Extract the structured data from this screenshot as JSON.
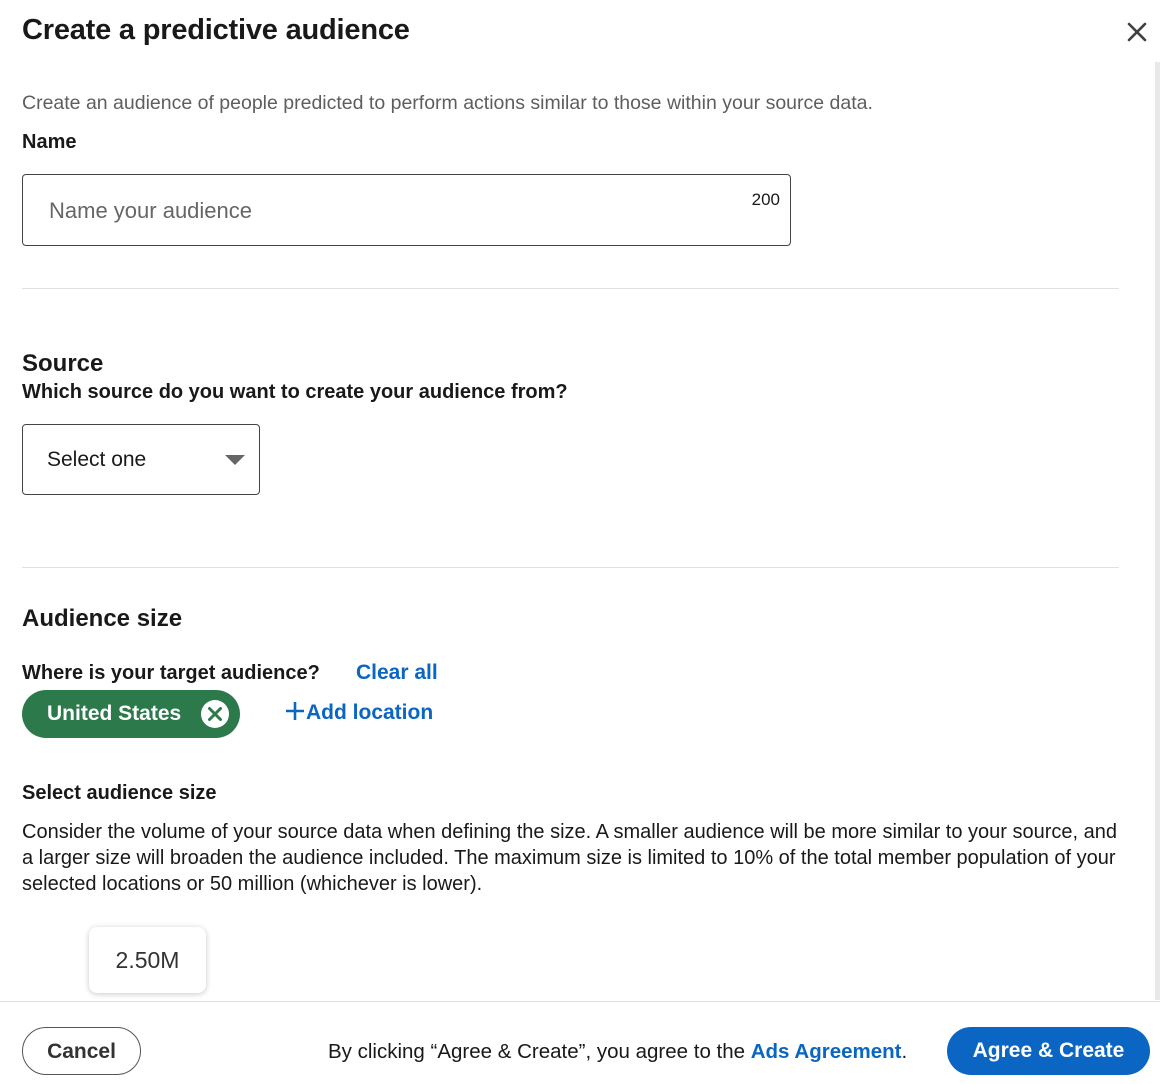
{
  "modal": {
    "title": "Create a predictive audience",
    "intro": "Create an audience of people predicted to perform actions similar to those within your source data."
  },
  "name_field": {
    "label": "Name",
    "placeholder": "Name your audience",
    "value": "",
    "char_limit": "200"
  },
  "source": {
    "title": "Source",
    "question": "Which source do you want to create your audience from?",
    "select_value": "Select one"
  },
  "audience_size": {
    "title": "Audience size",
    "location_question": "Where is your target audience?",
    "clear_all": "Clear all",
    "locations": [
      {
        "label": "United States"
      }
    ],
    "add_location": "Add location",
    "select_size_label": "Select audience size",
    "description": "Consider the volume of your source data when defining the size. A smaller audience will be more similar to your source, and a larger size will broaden the audience included. The maximum size is limited to 10% of the total member population of your selected locations or 50 million (whichever is lower).",
    "size_value": "2.50M"
  },
  "footer": {
    "cancel_label": "Cancel",
    "agreement_prefix": "By clicking “Agree & Create”, you agree to the ",
    "agreement_link": "Ads Agreement",
    "agreement_suffix": ".",
    "create_label": "Agree & Create"
  },
  "colors": {
    "primary_blue": "#0a66c2",
    "location_pill_green": "#2c7a4b",
    "text_dark": "#191919",
    "text_muted": "#5e5e5e",
    "divider": "#e0e0e0"
  },
  "icons": {
    "close": "close-icon",
    "remove_location": "close-circle-icon",
    "add": "plus-icon",
    "dropdown": "caret-down-icon"
  }
}
